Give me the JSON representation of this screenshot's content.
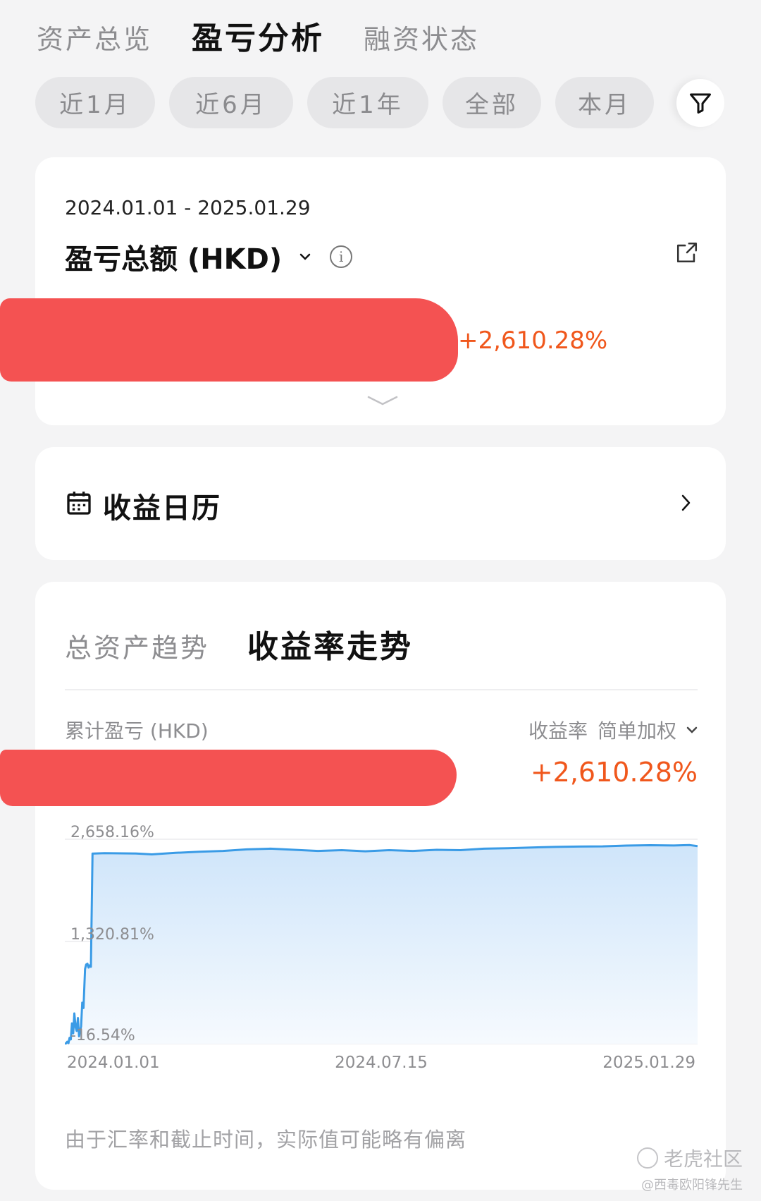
{
  "top_tabs": [
    {
      "label": "资产总览",
      "active": false
    },
    {
      "label": "盈亏分析",
      "active": true
    },
    {
      "label": "融资状态",
      "active": false
    }
  ],
  "period_chips": [
    "近1月",
    "近6月",
    "近1年",
    "全部",
    "本月"
  ],
  "summary": {
    "date_range": "2024.01.01 - 2025.01.29",
    "title": "盈亏总额 (HKD)",
    "return_pct": "+2,610.28%"
  },
  "calendar": {
    "title": "收益日历"
  },
  "trend": {
    "tabs": [
      {
        "label": "总资产趋势",
        "active": false
      },
      {
        "label": "收益率走势",
        "active": true
      }
    ],
    "cum_label": "累计盈亏 (HKD)",
    "metric_label": "收益率",
    "weighting_label": "简单加权",
    "return_pct": "+2,610.28%",
    "footnote": "由于汇率和截止时间，实际值可能略有偏离"
  },
  "chart_data": {
    "type": "area",
    "y_ticks": [
      "2,658.16%",
      "1,320.81%",
      "-16.54%"
    ],
    "x_ticks": [
      "2024.01.01",
      "2024.07.15",
      "2025.01.29"
    ],
    "ylim": [
      -16.54,
      2658.16
    ],
    "color": "#3a9be6",
    "points": [
      [
        0,
        -16
      ],
      [
        0.8,
        -12
      ],
      [
        1.5,
        10
      ],
      [
        2.3,
        -8
      ],
      [
        3,
        60
      ],
      [
        3.8,
        40
      ],
      [
        4.5,
        250
      ],
      [
        5.3,
        120
      ],
      [
        6,
        380
      ],
      [
        6.8,
        200
      ],
      [
        7.5,
        150
      ],
      [
        8.3,
        320
      ],
      [
        9,
        80
      ],
      [
        10.3,
        210
      ],
      [
        11,
        520
      ],
      [
        11.8,
        450
      ],
      [
        12.8,
        960
      ],
      [
        13.5,
        1020
      ],
      [
        14.3,
        1030
      ],
      [
        15,
        980
      ],
      [
        15.8,
        1010
      ],
      [
        16.5,
        990
      ],
      [
        17.5,
        2470
      ],
      [
        25,
        2476
      ],
      [
        45,
        2472
      ],
      [
        55,
        2460
      ],
      [
        70,
        2480
      ],
      [
        85,
        2495
      ],
      [
        100,
        2505
      ],
      [
        115,
        2525
      ],
      [
        130,
        2535
      ],
      [
        145,
        2520
      ],
      [
        160,
        2505
      ],
      [
        175,
        2515
      ],
      [
        190,
        2500
      ],
      [
        205,
        2515
      ],
      [
        220,
        2505
      ],
      [
        235,
        2520
      ],
      [
        250,
        2515
      ],
      [
        265,
        2535
      ],
      [
        280,
        2540
      ],
      [
        295,
        2550
      ],
      [
        310,
        2558
      ],
      [
        325,
        2562
      ],
      [
        340,
        2565
      ],
      [
        355,
        2575
      ],
      [
        370,
        2580
      ],
      [
        385,
        2576
      ],
      [
        395,
        2582
      ],
      [
        400,
        2568
      ]
    ]
  },
  "watermark": {
    "brand": "老虎社区",
    "user": "@西毒欧阳锋先生"
  }
}
